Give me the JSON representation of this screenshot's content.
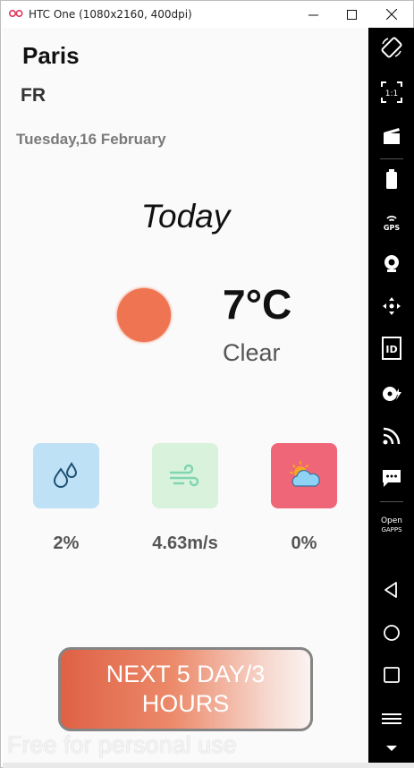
{
  "window": {
    "title": "HTC One (1080x2160, 400dpi)",
    "controls": {
      "minimize": "—",
      "maximize": "☐",
      "close": "✕"
    }
  },
  "weather": {
    "city": "Paris",
    "country": "FR",
    "date": "Tuesday,16 February",
    "day_label": "Today",
    "temperature": "7°C",
    "condition": "Clear"
  },
  "stats": {
    "humidity": "2%",
    "wind": "4.63m/s",
    "clouds": "0%"
  },
  "next_button": {
    "label": "NEXT 5 DAY/3 HOURS"
  },
  "watermark": "Free for personal use",
  "colors": {
    "sun": "#ef7452",
    "humidity_tile": "#bfe1f6",
    "wind_tile": "#d9f2dc",
    "clouds_tile": "#ef6678",
    "button_gradient_start": "#df6145"
  },
  "sidebar_icons": [
    "rotate-icon",
    "one-to-one-icon",
    "clapperboard-icon",
    "battery-icon",
    "gps-icon",
    "webcam-icon",
    "move-icon",
    "identity-icon",
    "disk-icon",
    "cast-icon",
    "sms-icon",
    "open-gapps-icon",
    "back-icon",
    "home-icon",
    "recents-icon",
    "menu-icon",
    "scroll-down-icon"
  ],
  "sidebar": {
    "gps_label": "GPS",
    "id_label": "ID",
    "open_gapps_label": "Open\nGAPPS",
    "one_to_one_label": "1:1"
  }
}
